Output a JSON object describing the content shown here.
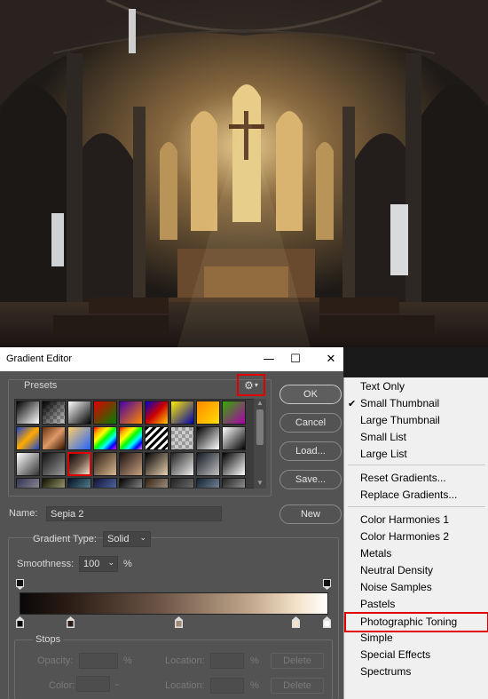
{
  "dialog": {
    "title": "Gradient Editor",
    "presets_label": "Presets",
    "ok_label": "OK",
    "cancel_label": "Cancel",
    "load_label": "Load...",
    "save_label": "Save...",
    "name_label": "Name:",
    "name_value": "Sepia 2",
    "new_label": "New",
    "gradient_type_label": "Gradient Type:",
    "gradient_type_value": "Solid",
    "smoothness_label": "Smoothness:",
    "smoothness_value": "100",
    "percent": "%",
    "stops_label": "Stops",
    "opacity_label": "Opacity:",
    "color_label": "Color:",
    "location_label": "Location:",
    "delete_label": "Delete"
  },
  "window_buttons": {
    "minimize": "—",
    "maximize": "☐",
    "close": "✕"
  },
  "gear_icon": "gear-icon",
  "highlight_color": "#e00000",
  "menu": {
    "items": [
      {
        "label": "Text Only"
      },
      {
        "label": "Small Thumbnail",
        "checked": true
      },
      {
        "label": "Large Thumbnail"
      },
      {
        "label": "Small List"
      },
      {
        "label": "Large List"
      },
      {
        "label": "Reset Gradients..."
      },
      {
        "label": "Replace Gradients..."
      },
      {
        "label": "Color Harmonies 1"
      },
      {
        "label": "Color Harmonies 2"
      },
      {
        "label": "Metals"
      },
      {
        "label": "Neutral Density"
      },
      {
        "label": "Noise Samples"
      },
      {
        "label": "Pastels"
      },
      {
        "label": "Photographic Toning",
        "highlighted": true
      },
      {
        "label": "Simple"
      },
      {
        "label": "Special Effects"
      },
      {
        "label": "Spectrums"
      }
    ],
    "checkmark": "✔"
  }
}
